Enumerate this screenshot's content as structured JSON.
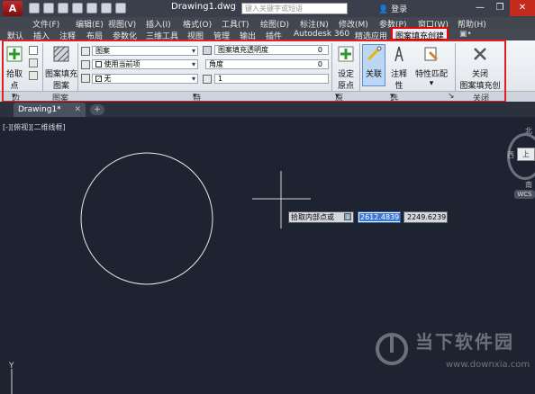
{
  "title_bar": {
    "doc_title": "Drawing1.dwg",
    "search_placeholder": "键入关键字或短语",
    "login_label": "登录",
    "window_buttons": [
      "—",
      "❐",
      "✕"
    ]
  },
  "menu": [
    "文件(F)",
    "编辑(E)",
    "视图(V)",
    "插入(I)",
    "格式(O)",
    "工具(T)",
    "绘图(D)",
    "标注(N)",
    "修改(M)",
    "参数(P)",
    "窗口(W)",
    "帮助(H)"
  ],
  "ribbon_tabs": {
    "items": [
      "默认",
      "插入",
      "注释",
      "布局",
      "参数化",
      "三维工具",
      "视图",
      "管理",
      "输出",
      "插件",
      "Autodesk 360",
      "精选应用",
      "图案填充创建"
    ],
    "active": "图案填充创建"
  },
  "ribbon": {
    "boundary": {
      "pick_point": "拾取点",
      "panel": "边界"
    },
    "pattern": {
      "button_line1": "图案填充",
      "button_line2": "图案",
      "panel": "图案"
    },
    "properties": {
      "type_combo": "图案",
      "color_combo": "使用当前项",
      "bg_combo": "无",
      "transparency_label": "图案填充透明度",
      "transparency_value": "0",
      "angle_label": "角度",
      "angle_value": "0",
      "scale_value": "1",
      "panel": "特性"
    },
    "origin": {
      "set_line1": "设定",
      "set_line2": "原点",
      "panel": "原点"
    },
    "options": {
      "associative": "关联",
      "annotative": "注释性",
      "match_line1": "特性匹配",
      "panel": "选项"
    },
    "close": {
      "line1": "关闭",
      "line2": "图案填充创建",
      "panel": "关闭"
    }
  },
  "doc_tab": {
    "name": "Drawing1*"
  },
  "viewport": {
    "label": "[-][俯视][二维线框]",
    "prompt": "拾取内部点或",
    "coord_x": "2612.4839",
    "coord_y": "2249.6239",
    "viewcube": {
      "north": "北",
      "west": "西",
      "south": "南",
      "top": "上",
      "wcs": "WCS"
    },
    "ucs_label": "Y"
  },
  "watermark": {
    "brand": "当下软件园",
    "url": "www.downxia.com"
  },
  "colors": {
    "canvas": "#1d2331",
    "highlight": "#e02020",
    "accent": "#3a78d8"
  }
}
